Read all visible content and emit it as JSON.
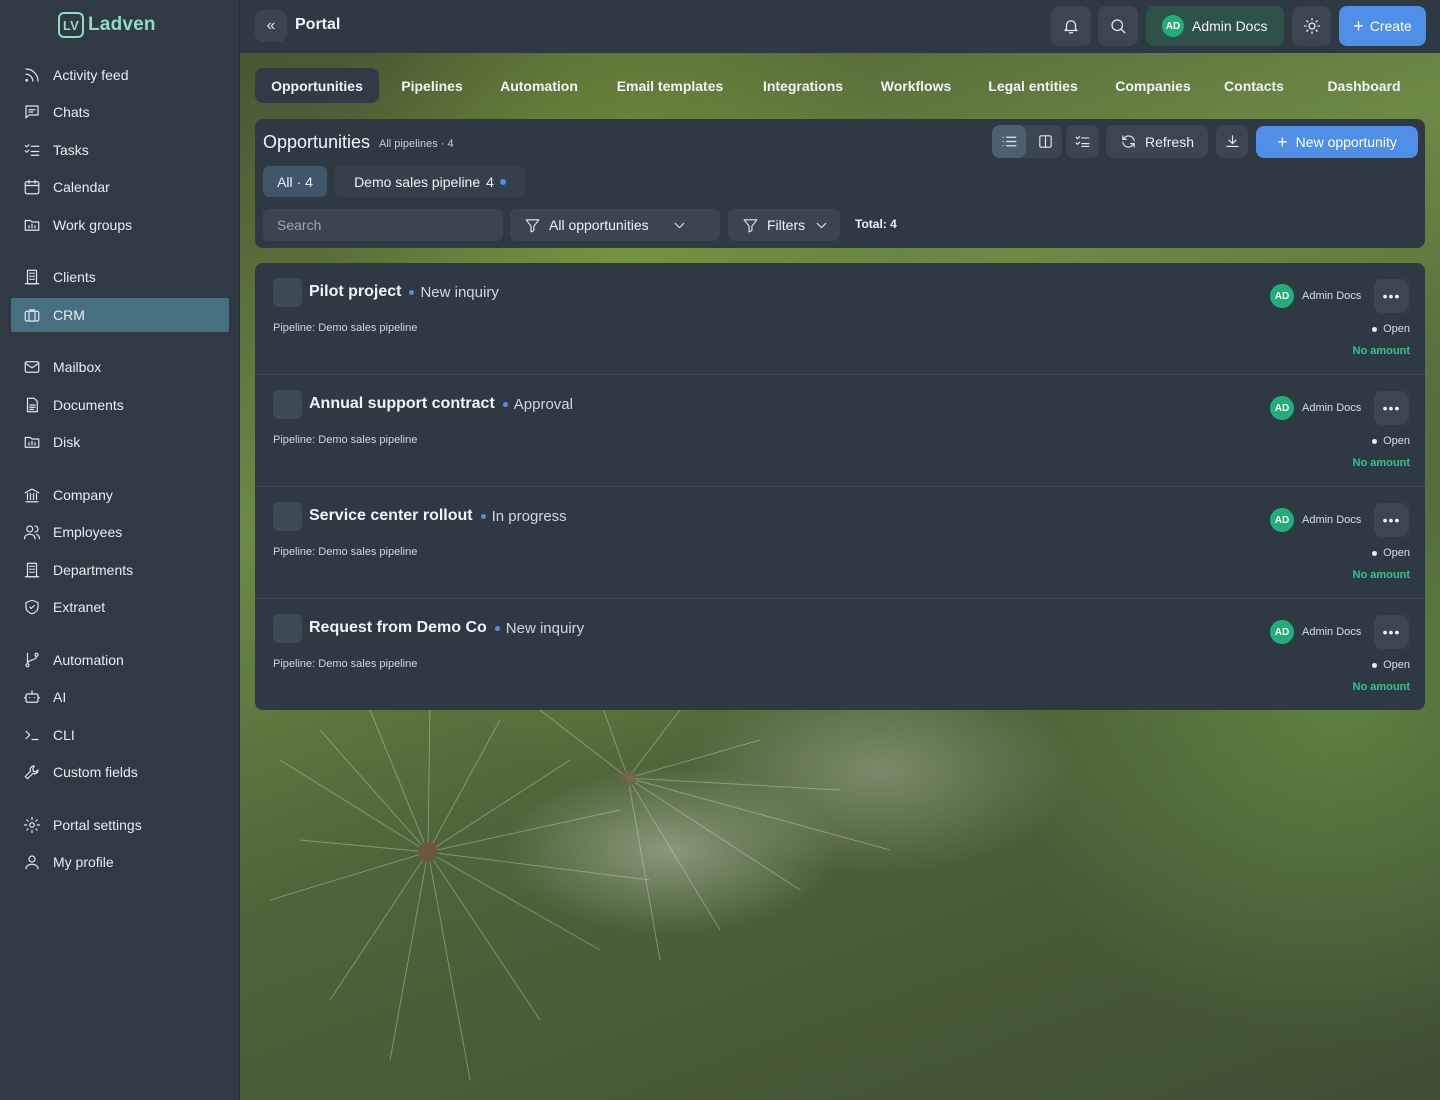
{
  "app": {
    "logo_text": "Ladven",
    "logo_mark": "LV",
    "accent": "#4f8fe8",
    "brand": "#8fdcc2"
  },
  "sidebar": {
    "items": [
      {
        "label": "Activity feed",
        "icon": "rss-icon"
      },
      {
        "label": "Chats",
        "icon": "chat-icon"
      },
      {
        "label": "Tasks",
        "icon": "tasks-icon"
      },
      {
        "label": "Calendar",
        "icon": "calendar-icon"
      },
      {
        "label": "Work groups",
        "icon": "folder-icon"
      },
      {
        "label": "Clients",
        "icon": "building-icon"
      },
      {
        "label": "CRM",
        "icon": "briefcase-icon",
        "active": true
      },
      {
        "label": "Mailbox",
        "icon": "mail-icon"
      },
      {
        "label": "Documents",
        "icon": "document-icon"
      },
      {
        "label": "Disk",
        "icon": "folder-icon"
      },
      {
        "label": "Company",
        "icon": "bank-icon"
      },
      {
        "label": "Employees",
        "icon": "users-icon"
      },
      {
        "label": "Departments",
        "icon": "building-icon"
      },
      {
        "label": "Extranet",
        "icon": "shield-icon"
      },
      {
        "label": "Automation",
        "icon": "branch-icon"
      },
      {
        "label": "AI",
        "icon": "bot-icon"
      },
      {
        "label": "CLI",
        "icon": "terminal-icon"
      },
      {
        "label": "Custom fields",
        "icon": "wrench-icon"
      },
      {
        "label": "Portal settings",
        "icon": "gear-icon"
      },
      {
        "label": "My profile",
        "icon": "user-icon"
      }
    ]
  },
  "topbar": {
    "title": "Portal",
    "user_initials": "AD",
    "user_name": "Admin Docs",
    "create_label": "Create"
  },
  "tabs": [
    {
      "label": "Opportunities",
      "active": true
    },
    {
      "label": "Pipelines"
    },
    {
      "label": "Automation"
    },
    {
      "label": "Email templates"
    },
    {
      "label": "Integrations"
    },
    {
      "label": "Workflows"
    },
    {
      "label": "Legal entities"
    },
    {
      "label": "Companies"
    },
    {
      "label": "Contacts"
    },
    {
      "label": "Dashboard"
    }
  ],
  "panel": {
    "title": "Opportunities",
    "subtitle": "All pipelines · 4",
    "refresh_label": "Refresh",
    "new_label": "New opportunity",
    "chip_all": "All · 4",
    "chip_pipeline": "Demo sales pipeline",
    "chip_pipeline_count": "4",
    "search_placeholder": "Search",
    "filter_view": "All opportunities",
    "filters_label": "Filters",
    "total": "Total: 4"
  },
  "rows": [
    {
      "title": "Pilot project",
      "stage": "New inquiry",
      "pipeline": "Pipeline: Demo sales pipeline",
      "owner_initials": "AD",
      "owner": "Admin Docs",
      "status": "Open",
      "amount": "No amount"
    },
    {
      "title": "Annual support contract",
      "stage": "Approval",
      "pipeline": "Pipeline: Demo sales pipeline",
      "owner_initials": "AD",
      "owner": "Admin Docs",
      "status": "Open",
      "amount": "No amount"
    },
    {
      "title": "Service center rollout",
      "stage": "In progress",
      "pipeline": "Pipeline: Demo sales pipeline",
      "owner_initials": "AD",
      "owner": "Admin Docs",
      "status": "Open",
      "amount": "No amount"
    },
    {
      "title": "Request from Demo Co",
      "stage": "New inquiry",
      "pipeline": "Pipeline: Demo sales pipeline",
      "owner_initials": "AD",
      "owner": "Admin Docs",
      "status": "Open",
      "amount": "No amount"
    }
  ]
}
